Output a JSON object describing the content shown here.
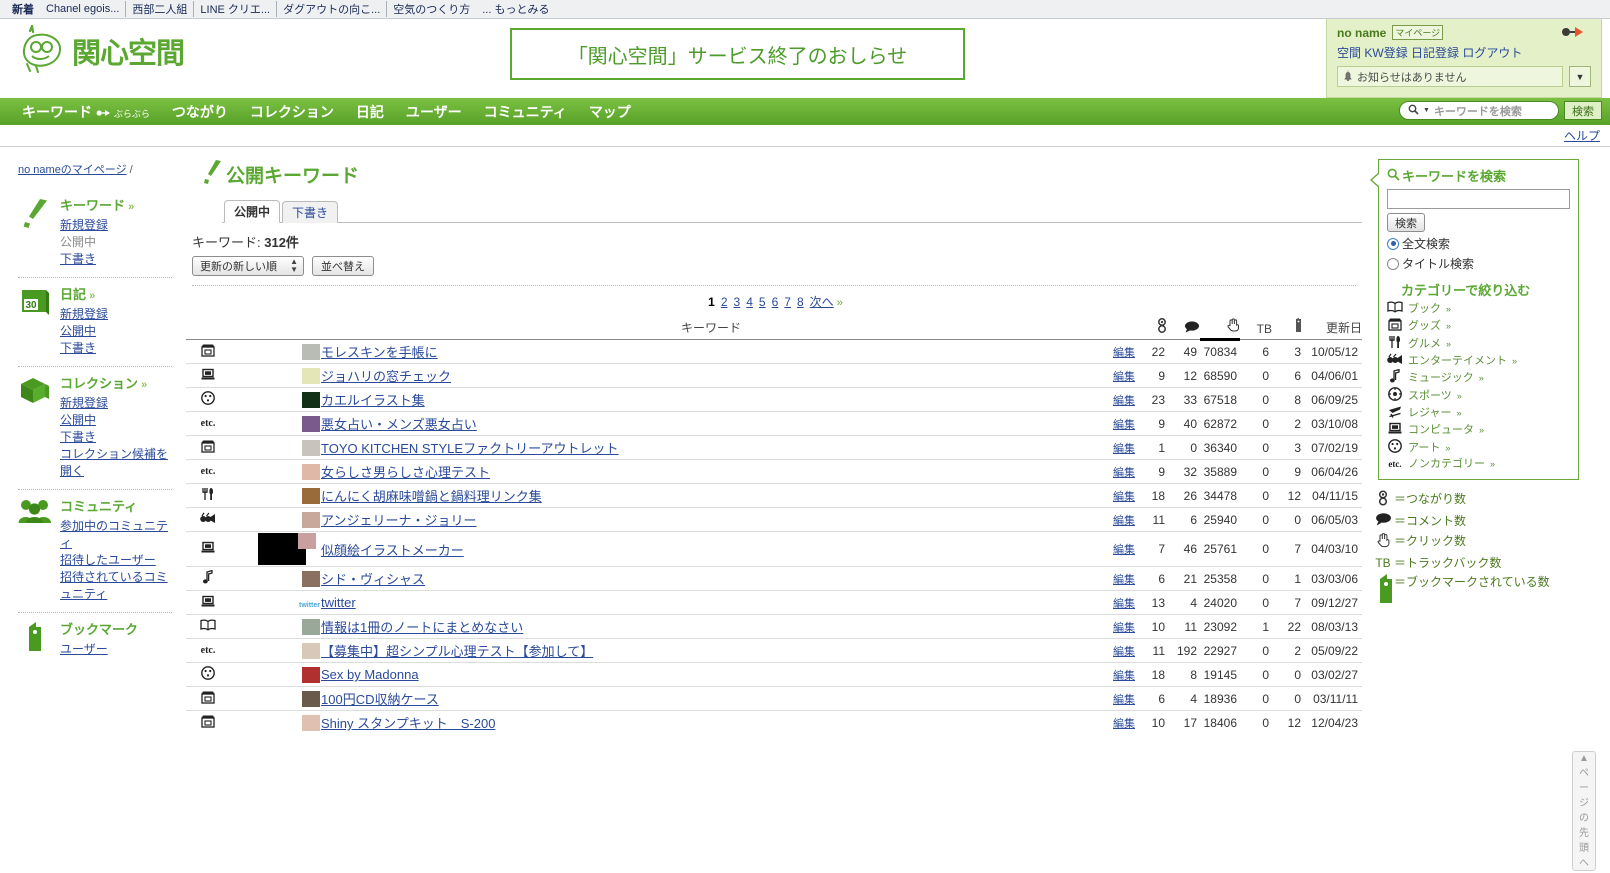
{
  "browser": {
    "bookmarks": [
      {
        "label": "新着",
        "bold": true,
        "sep": false
      },
      {
        "label": "Chanel egois...",
        "bold": false,
        "sep": false
      },
      {
        "label": "西部二人組",
        "bold": false,
        "sep": true
      },
      {
        "label": "LINE クリエ...",
        "bold": false,
        "sep": true
      },
      {
        "label": "ダグアウトの向こ...",
        "bold": false,
        "sep": true
      },
      {
        "label": "空気のつくり方",
        "bold": false,
        "sep": true
      },
      {
        "label": "... もっとみる",
        "bold": false,
        "sep": false
      }
    ]
  },
  "header": {
    "site_name": "関心空間",
    "banner_text": "「関心空間」サービス終了のおしらせ",
    "user": {
      "name": "no name",
      "mypage_badge": "マイページ",
      "links": [
        "空間",
        "KW登録",
        "日記登録",
        "ログアウト"
      ],
      "notice_text": "お知らせはありません"
    }
  },
  "nav": {
    "items": [
      {
        "label": "キーワード",
        "sub": "ぶらぶら"
      },
      {
        "label": "つながり",
        "sub": ""
      },
      {
        "label": "コレクション",
        "sub": ""
      },
      {
        "label": "日記",
        "sub": ""
      },
      {
        "label": "ユーザー",
        "sub": ""
      },
      {
        "label": "コミュニティ",
        "sub": ""
      },
      {
        "label": "マップ",
        "sub": ""
      }
    ],
    "search_placeholder": "キーワードを検索",
    "search_button": "検索",
    "help": "ヘルプ"
  },
  "sidebar_left": {
    "breadcrumb_user": "no nameのマイページ",
    "breadcrumb_sep": "/",
    "blocks": [
      {
        "icon": "exclamation-icon",
        "title": "キーワード",
        "chev": "»",
        "links": [
          {
            "label": "新規登録",
            "active": true
          },
          {
            "label": "公開中",
            "active": false
          },
          {
            "label": "下書き",
            "active": true
          }
        ]
      },
      {
        "icon": "calendar-icon",
        "title": "日記",
        "chev": "»",
        "links": [
          {
            "label": "新規登録",
            "active": true
          },
          {
            "label": "公開中",
            "active": true
          },
          {
            "label": "下書き",
            "active": true
          }
        ]
      },
      {
        "icon": "books-icon",
        "title": "コレクション",
        "chev": "»",
        "links": [
          {
            "label": "新規登録",
            "active": true
          },
          {
            "label": "公開中",
            "active": true
          },
          {
            "label": "下書き",
            "active": true
          },
          {
            "label": "コレクション候補を開く",
            "active": true
          }
        ]
      },
      {
        "icon": "people-icon",
        "title": "コミュニティ",
        "chev": "",
        "links": [
          {
            "label": "参加中のコミュニティ",
            "active": true
          },
          {
            "label": "招待したユーザー",
            "active": true
          },
          {
            "label": "招待されているコミュニティ",
            "active": true
          }
        ]
      },
      {
        "icon": "bookmark-icon",
        "title": "ブックマーク",
        "chev": "",
        "links": [
          {
            "label": "ユーザー",
            "active": true
          }
        ]
      }
    ]
  },
  "main": {
    "page_title": "公開キーワード",
    "tabs": [
      {
        "label": "公開中",
        "active": true
      },
      {
        "label": "下書き",
        "active": false
      }
    ],
    "count_label": "キーワード: ",
    "count_value": "312件",
    "sort_selected": "更新の新しい順",
    "sort_button": "並べ替え",
    "pager": {
      "current": "1",
      "pages": [
        "2",
        "3",
        "4",
        "5",
        "6",
        "7",
        "8"
      ],
      "next": "次へ",
      "next_chev": "»"
    },
    "table": {
      "headers": {
        "keyword": "キーワード",
        "connections": "connections-icon",
        "comments": "comment-icon",
        "clicks": "hand-click-icon",
        "tb": "TB",
        "bookmarks": "bookmark-icon",
        "updated": "更新日"
      },
      "edit_label": "編集",
      "rows": [
        {
          "cat": "goods-icon",
          "cat_label": "グッズ",
          "thumb": "#b9bcb4",
          "name": "モレスキンを手帳に",
          "conn": "22",
          "cmt": "49",
          "clk": "70834",
          "tb": "6",
          "bm": "3",
          "date": "10/05/12"
        },
        {
          "cat": "computer-icon",
          "cat_label": "コンピュータ",
          "thumb": "#e4e6b8",
          "name": "ジョハリの窓チェック",
          "conn": "9",
          "cmt": "12",
          "clk": "68590",
          "tb": "0",
          "bm": "6",
          "date": "04/06/01"
        },
        {
          "cat": "art-icon",
          "cat_label": "アート",
          "thumb": "#123016",
          "name": "カエルイラスト集",
          "conn": "23",
          "cmt": "33",
          "clk": "67518",
          "tb": "0",
          "bm": "8",
          "date": "06/09/25"
        },
        {
          "cat": "etc",
          "cat_label": "ノンカテゴリー",
          "thumb": "#7a5a8c",
          "name": "悪女占い・メンズ悪女占い",
          "conn": "9",
          "cmt": "40",
          "clk": "62872",
          "tb": "0",
          "bm": "2",
          "date": "03/10/08"
        },
        {
          "cat": "goods-icon",
          "cat_label": "グッズ",
          "thumb": "#c8c3bd",
          "name": "TOYO KITCHEN STYLEファクトリーアウトレット",
          "conn": "1",
          "cmt": "0",
          "clk": "36340",
          "tb": "0",
          "bm": "3",
          "date": "07/02/19"
        },
        {
          "cat": "etc",
          "cat_label": "ノンカテゴリー",
          "thumb": "#e0b8a8",
          "name": "女らしさ男らしさ心理テスト",
          "conn": "9",
          "cmt": "32",
          "clk": "35889",
          "tb": "0",
          "bm": "9",
          "date": "06/04/26"
        },
        {
          "cat": "gourmet-icon",
          "cat_label": "グルメ",
          "thumb": "#9a6b3a",
          "name": "にんにく胡麻味噌鍋と鍋料理リンク集",
          "conn": "18",
          "cmt": "26",
          "clk": "34478",
          "tb": "0",
          "bm": "12",
          "date": "04/11/15"
        },
        {
          "cat": "entertainment-icon",
          "cat_label": "エンターテイメント",
          "thumb": "#c8a89a",
          "name": "アンジェリーナ・ジョリー",
          "conn": "11",
          "cmt": "6",
          "clk": "25940",
          "tb": "0",
          "bm": "0",
          "date": "06/05/03"
        },
        {
          "cat": "computer-icon",
          "cat_label": "コンピュータ",
          "thumb": "#000000",
          "name": "似顔絵イラストメーカー",
          "conn": "7",
          "cmt": "46",
          "clk": "25761",
          "tb": "0",
          "bm": "7",
          "date": "04/03/10",
          "wide_thumb": true
        },
        {
          "cat": "music-icon",
          "cat_label": "ミュージック",
          "thumb": "#8a7060",
          "name": "シド・ヴィシャス",
          "conn": "6",
          "cmt": "21",
          "clk": "25358",
          "tb": "0",
          "bm": "1",
          "date": "03/03/06"
        },
        {
          "cat": "computer-icon",
          "cat_label": "コンピュータ",
          "thumb": "#7fc8e8",
          "name": "twitter",
          "conn": "13",
          "cmt": "4",
          "clk": "24020",
          "tb": "0",
          "bm": "7",
          "date": "09/12/27",
          "thumb_text": "twitter"
        },
        {
          "cat": "book-icon",
          "cat_label": "ブック",
          "thumb": "#9aa89a",
          "name": "情報は1冊のノートにまとめなさい",
          "conn": "10",
          "cmt": "11",
          "clk": "23092",
          "tb": "1",
          "bm": "22",
          "date": "08/03/13"
        },
        {
          "cat": "etc",
          "cat_label": "ノンカテゴリー",
          "thumb": "#d8c8b8",
          "name": "【募集中】超シンプル心理テスト【参加して】",
          "conn": "11",
          "cmt": "192",
          "clk": "22927",
          "tb": "0",
          "bm": "2",
          "date": "05/09/22"
        },
        {
          "cat": "art-icon",
          "cat_label": "アート",
          "thumb": "#b03030",
          "name": "Sex by Madonna",
          "conn": "18",
          "cmt": "8",
          "clk": "19145",
          "tb": "0",
          "bm": "0",
          "date": "03/02/27"
        },
        {
          "cat": "goods-icon",
          "cat_label": "グッズ",
          "thumb": "#6a5a4a",
          "name": "100円CD収納ケース",
          "conn": "6",
          "cmt": "4",
          "clk": "18936",
          "tb": "0",
          "bm": "0",
          "date": "03/11/11"
        },
        {
          "cat": "goods-icon",
          "cat_label": "グッズ",
          "thumb": "#e0c0b0",
          "name": "Shiny スタンプキット　S-200",
          "conn": "10",
          "cmt": "17",
          "clk": "18406",
          "tb": "0",
          "bm": "12",
          "date": "12/04/23"
        }
      ]
    }
  },
  "sidebar_right": {
    "search_title": "キーワードを検索",
    "search_value": "",
    "search_button": "検索",
    "radios": [
      {
        "label": "全文検索",
        "selected": true
      },
      {
        "label": "タイトル検索",
        "selected": false
      }
    ],
    "category_head": "カテゴリーで絞り込む",
    "categories": [
      {
        "icon": "book-icon",
        "label": "ブック",
        "chev": "»"
      },
      {
        "icon": "goods-icon",
        "label": "グッズ",
        "chev": "»"
      },
      {
        "icon": "gourmet-icon",
        "label": "グルメ",
        "chev": "»"
      },
      {
        "icon": "entertainment-icon",
        "label": "エンターテイメント",
        "chev": "»"
      },
      {
        "icon": "music-icon",
        "label": "ミュージック",
        "chev": "»"
      },
      {
        "icon": "sports-icon",
        "label": "スポーツ",
        "chev": "»"
      },
      {
        "icon": "leisure-icon",
        "label": "レジャー",
        "chev": "»"
      },
      {
        "icon": "computer-icon",
        "label": "コンピュータ",
        "chev": "»"
      },
      {
        "icon": "art-icon",
        "label": "アート",
        "chev": "»"
      },
      {
        "icon": "etc",
        "label": "ノンカテゴリー",
        "chev": "»"
      }
    ],
    "legend": [
      {
        "icon": "connections-icon",
        "text": "＝つながり数"
      },
      {
        "icon": "comment-icon",
        "text": "＝コメント数"
      },
      {
        "icon": "hand-click-icon",
        "text": "＝クリック数"
      },
      {
        "icon": "TB",
        "text": "＝トラックバック数"
      },
      {
        "icon": "bookmark-icon",
        "text": "＝ブックマークされている数"
      }
    ]
  },
  "footer": {
    "page_top": "ページの先頭へ"
  }
}
